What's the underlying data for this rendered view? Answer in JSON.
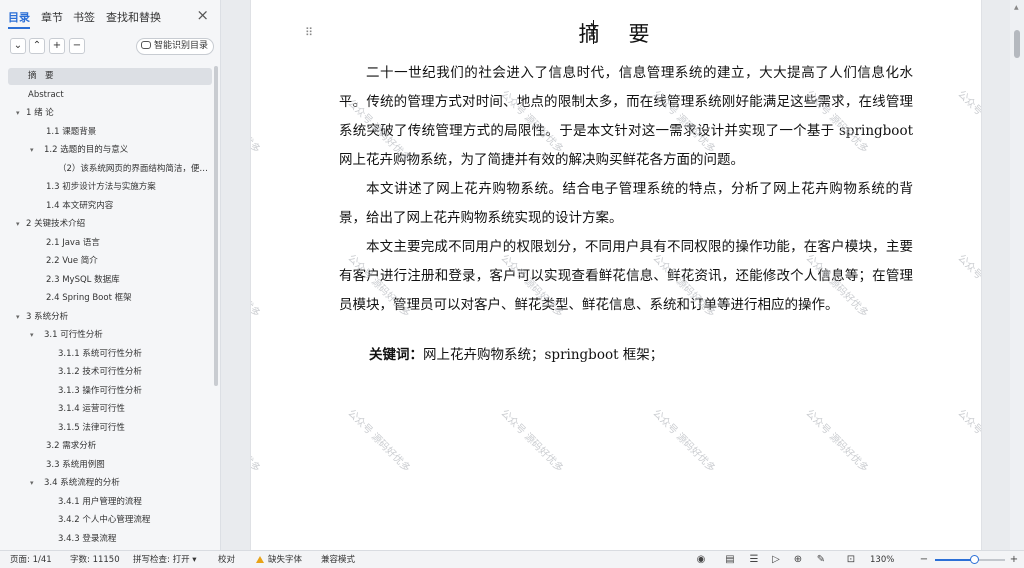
{
  "sidebar": {
    "tabs": [
      {
        "label": "目录"
      },
      {
        "label": "章节"
      },
      {
        "label": "书签"
      },
      {
        "label": "查找和替换"
      }
    ],
    "close_icon": "×",
    "tools": {
      "collapse": "⌄",
      "expand": "⌃",
      "add": "+",
      "remove": "−",
      "smart_label": "智能识别目录"
    },
    "outline": [
      {
        "label": "摘　要",
        "level": 0,
        "selected": true
      },
      {
        "label": "Abstract",
        "level": 0
      },
      {
        "label": "1 绪  论",
        "level": 0,
        "caret": true
      },
      {
        "label": "1.1 课题背景",
        "level": 1
      },
      {
        "label": "1.2 选题的目的与意义",
        "level": 1,
        "caret": true
      },
      {
        "label": "（2）该系统网页的界面结构简洁，便…",
        "level": 2
      },
      {
        "label": "1.3 初步设计方法与实施方案",
        "level": 1
      },
      {
        "label": "1.4 本文研究内容",
        "level": 1
      },
      {
        "label": "2 关键技术介绍",
        "level": 0,
        "caret": true
      },
      {
        "label": "2.1 Java 语言",
        "level": 1
      },
      {
        "label": "2.2 Vue 简介",
        "level": 1
      },
      {
        "label": "2.3    MySQL 数据库",
        "level": 1
      },
      {
        "label": "2.4 Spring Boot 框架",
        "level": 1
      },
      {
        "label": "3 系统分析",
        "level": 0,
        "caret": true
      },
      {
        "label": "3.1 可行性分析",
        "level": 1,
        "caret": true
      },
      {
        "label": "3.1.1 系统可行性分析",
        "level": 2
      },
      {
        "label": "3.1.2    技术可行性分析",
        "level": 2
      },
      {
        "label": "3.1.3  操作可行性分析",
        "level": 2
      },
      {
        "label": "3.1.4 运营可行性",
        "level": 2
      },
      {
        "label": "3.1.5 法律可行性",
        "level": 2
      },
      {
        "label": "3.2 需求分析",
        "level": 1
      },
      {
        "label": "3.3 系统用例图",
        "level": 1
      },
      {
        "label": "3.4 系统流程的分析",
        "level": 1,
        "caret": true
      },
      {
        "label": "3.4.1  用户管理的流程",
        "level": 2
      },
      {
        "label": "3.4.2  个人中心管理流程",
        "level": 2
      },
      {
        "label": "3.4.3  登录流程",
        "level": 2
      }
    ]
  },
  "document": {
    "title": "摘　要",
    "paragraphs": [
      "二十一世纪我们的社会进入了信息时代，信息管理系统的建立，大大提高了人们信息化水平。传统的管理方式对时间、地点的限制太多，而在线管理系统刚好能满足这些需求，在线管理系统突破了传统管理方式的局限性。于是本文针对这一需求设计并实现了一个基于 springboot 网上花卉购物系统，为了简捷并有效的解决购买鲜花各方面的问题。",
      "本文讲述了网上花卉购物系统。结合电子管理系统的特点，分析了网上花卉购物系统的背景，给出了网上花卉购物系统实现的设计方案。",
      "本文主要完成不同用户的权限划分，不同用户具有不同权限的操作功能，在客户模块，主要有客户进行注册和登录，客户可以实现查看鲜花信息、鲜花资讯，还能修改个人信息等；在管理员模块，管理员可以对客户、鲜花类型、鲜花信息、系统和订单等进行相应的操作。"
    ],
    "keywords_label": "关键词：",
    "keywords_value": "网上花卉购物系统；springboot 框架；",
    "watermark": "公众号 源码好优多"
  },
  "statusbar": {
    "page": "页面: 1/41",
    "words": "字数: 11150",
    "spell": "拼写检查: 打开",
    "proof": "校对",
    "missing_font": "缺失字体",
    "compat": "兼容模式",
    "zoom": "130%",
    "zoom_level": 0.55,
    "icons": [
      "eye-icon",
      "page-view-icon",
      "list-icon",
      "play-icon",
      "globe-icon",
      "pen-icon",
      "fit-icon",
      "zoom-out-icon",
      "zoom-in-icon"
    ]
  },
  "colors": {
    "accent": "#2b6fd6",
    "warning": "#e8a317",
    "watermark": "#b9bcc1"
  }
}
